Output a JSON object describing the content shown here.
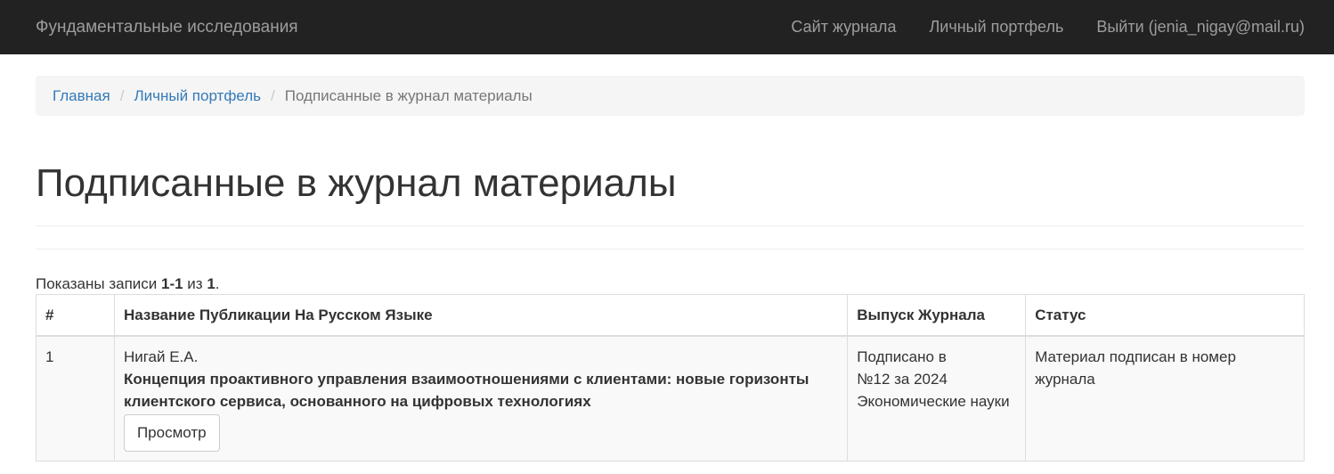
{
  "navbar": {
    "brand": "Фундаментальные исследования",
    "links": [
      "Сайт журнала",
      "Личный портфель",
      "Выйти (jenia_nigay@mail.ru)"
    ]
  },
  "breadcrumb": {
    "items": [
      "Главная",
      "Личный портфель"
    ],
    "separator": "/",
    "active": "Подписанные в журнал материалы"
  },
  "page": {
    "title": "Подписанные в журнал материалы"
  },
  "summary": {
    "prefix": "Показаны записи ",
    "range": "1-1",
    "of": " из ",
    "total": "1",
    "suffix": "."
  },
  "table": {
    "headers": [
      "#",
      "Название Публикации На Русском Языке",
      "Выпуск Журнала",
      "Статус"
    ],
    "rows": [
      {
        "num": "1",
        "authors": "Нигай Е.А.",
        "title": "Концепция проактивного управления взаимоотношениями с клиентами: новые горизонты клиентского сервиса, основанного на цифровых технологиях",
        "view_label": "Просмотр",
        "issue_line1": "Подписано в",
        "issue_line2": "№12 за 2024",
        "issue_line3": "Экономические науки",
        "status": "Материал подписан в номер журнала"
      }
    ]
  },
  "colors": {
    "navbar_bg": "#222222",
    "navbar_text": "#9d9d9d",
    "link": "#337ab7",
    "breadcrumb_bg": "#f5f5f5",
    "row_stripe": "#f9f9f9"
  }
}
